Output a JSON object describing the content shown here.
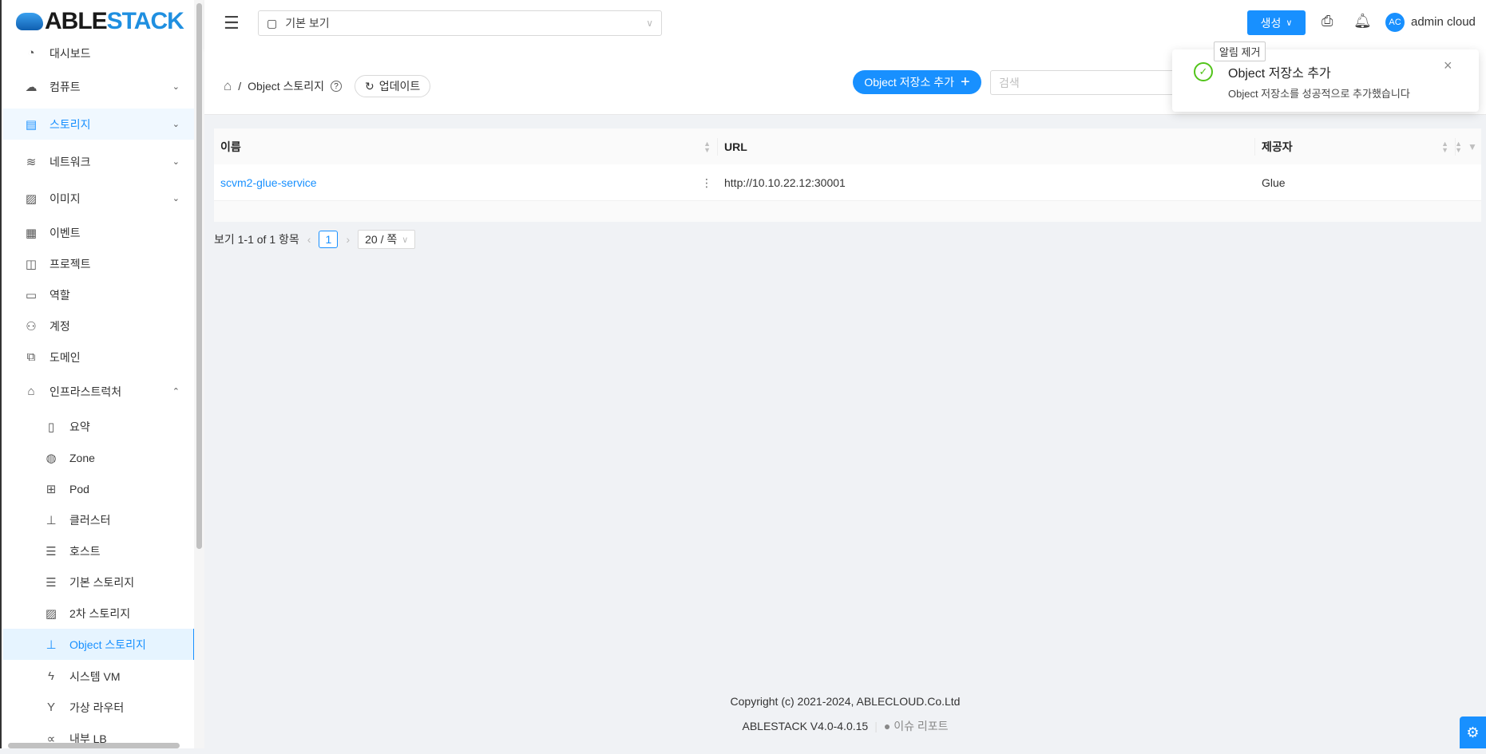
{
  "logo": {
    "part1": "ABLE",
    "part2": "STACK"
  },
  "sidebar": {
    "items": [
      {
        "label": "대시보드",
        "icon": "dashboard-icon",
        "glyph": "◔"
      },
      {
        "label": "컴퓨트",
        "icon": "cloud-icon",
        "glyph": "☁",
        "chev": "⌄"
      },
      {
        "label": "스토리지",
        "icon": "storage-icon",
        "glyph": "▤",
        "chev": "⌄"
      },
      {
        "label": "네트워크",
        "icon": "wifi-icon",
        "glyph": "≋",
        "chev": "⌄"
      },
      {
        "label": "이미지",
        "icon": "image-icon",
        "glyph": "▨",
        "chev": "⌄"
      },
      {
        "label": "이벤트",
        "icon": "calendar-icon",
        "glyph": "▦"
      },
      {
        "label": "프로젝트",
        "icon": "project-icon",
        "glyph": "◫"
      },
      {
        "label": "역할",
        "icon": "idcard-icon",
        "glyph": "▭"
      },
      {
        "label": "계정",
        "icon": "team-icon",
        "glyph": "⚇"
      },
      {
        "label": "도메인",
        "icon": "block-icon",
        "glyph": "⧉"
      },
      {
        "label": "인프라스트럭처",
        "icon": "bank-icon",
        "glyph": "⌂",
        "chev": "⌃"
      },
      {
        "label": "요약",
        "icon": "read-icon",
        "glyph": "▯"
      },
      {
        "label": "Zone",
        "icon": "globe-icon",
        "glyph": "◍"
      },
      {
        "label": "Pod",
        "icon": "appstore-icon",
        "glyph": "⊞"
      },
      {
        "label": "클러스터",
        "icon": "cluster-icon",
        "glyph": "⊥"
      },
      {
        "label": "호스트",
        "icon": "host-icon",
        "glyph": "☰"
      },
      {
        "label": "기본 스토리지",
        "icon": "database-icon",
        "glyph": "☰"
      },
      {
        "label": "2차 스토리지",
        "icon": "picture-icon",
        "glyph": "▨"
      },
      {
        "label": "Object 스토리지",
        "icon": "object-storage-icon",
        "glyph": "⊥"
      },
      {
        "label": "시스템 VM",
        "icon": "thunderbolt-icon",
        "glyph": "ϟ"
      },
      {
        "label": "가상 라우터",
        "icon": "fork-icon",
        "glyph": "Y"
      },
      {
        "label": "내부 LB",
        "icon": "share-icon",
        "glyph": "∝"
      }
    ]
  },
  "header": {
    "view_select": "기본 보기",
    "create": "생성",
    "username": "admin cloud",
    "avatar": "AC",
    "tooltip": "알림 제거"
  },
  "breadcrumb": {
    "current": "Object 스토리지",
    "refresh": "업데이트"
  },
  "actions": {
    "add": "Object 저장소 추가",
    "search_placeholder": "검색"
  },
  "table": {
    "columns": [
      "이름",
      "URL",
      "제공자"
    ],
    "rows": [
      {
        "name": "scvm2-glue-service",
        "url": "http://10.10.22.12:30001",
        "provider": "Glue"
      }
    ]
  },
  "pagination": {
    "summary": "보기 1-1 of 1 항목",
    "page": "1",
    "size": "20 / 쪽"
  },
  "toast": {
    "title": "Object 저장소 추가",
    "message": "Object 저장소를 성공적으로 추가했습니다"
  },
  "footer": {
    "copyright": "Copyright (c) 2021-2024, ABLECLOUD.Co.Ltd",
    "version": "ABLESTACK V4.0-4.0.15",
    "issue": "이슈 리포트"
  },
  "colors": {
    "accent": "#1890ff",
    "success": "#52c41a"
  }
}
